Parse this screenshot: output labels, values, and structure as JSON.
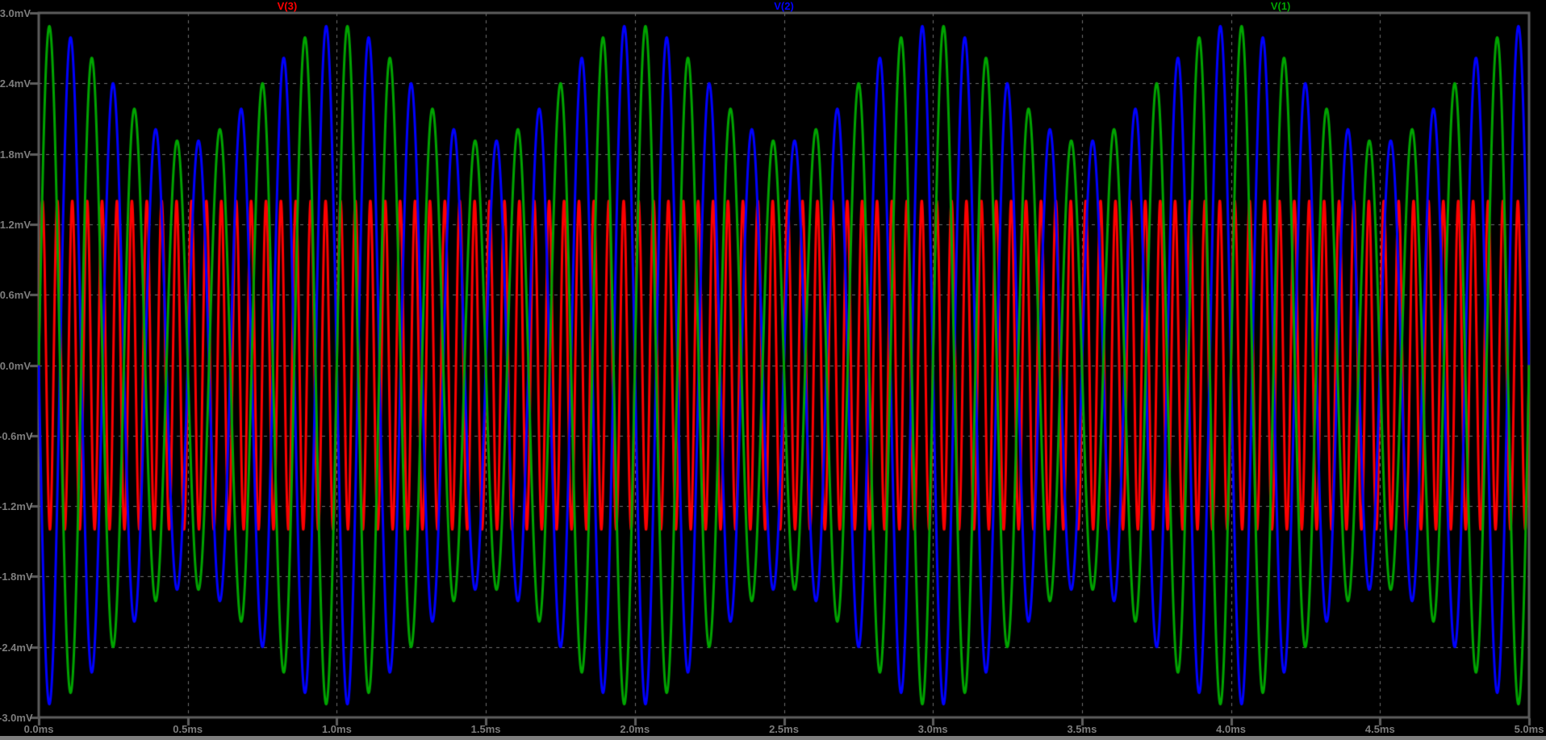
{
  "window": {
    "background_color": "#000000",
    "bottom_border_color": "#7f7f7f"
  },
  "plot": {
    "colors": {
      "grid": "#6f6f6f",
      "border": "#5e5e5e",
      "axis_text": "#7d7d7d",
      "plot_background": "#000000"
    },
    "trace_label_fractions": [
      0.1667,
      0.5,
      0.8333
    ]
  },
  "chart_data": {
    "type": "line",
    "title": "",
    "xlabel": "",
    "ylabel": "",
    "grid": true,
    "x_axis": {
      "unit": "ms",
      "min_ms": 0.0,
      "max_ms": 5.0,
      "tick_step_ms": 0.5,
      "tick_values_ms": [
        0.0,
        0.5,
        1.0,
        1.5,
        2.0,
        2.5,
        3.0,
        3.5,
        4.0,
        4.5,
        5.0
      ],
      "tick_labels": [
        "0.0ms",
        "0.5ms",
        "1.0ms",
        "1.5ms",
        "2.0ms",
        "2.5ms",
        "3.0ms",
        "3.5ms",
        "4.0ms",
        "4.5ms",
        "5.0ms"
      ]
    },
    "y_axis": {
      "unit": "mV",
      "min_mV": -3.0,
      "max_mV": 3.0,
      "tick_step_mV": 0.6,
      "tick_values_mV": [
        3.0,
        2.4,
        1.8,
        1.2,
        0.6,
        0.0,
        -0.6,
        -1.2,
        -1.8,
        -2.4,
        -3.0
      ],
      "tick_labels": [
        "3.0mV",
        "2.4mV",
        "1.8mV",
        "1.2mV",
        "0.6mV",
        "0.0mV",
        "-0.6mV",
        "-1.2mV",
        "-1.8mV",
        "-2.4mV",
        "-3.0mV"
      ]
    },
    "series": [
      {
        "name": "V(3)",
        "color": "#ff0000",
        "waveform": "sine",
        "amplitude_mV": 1.4,
        "carrier_Hz": 20000,
        "phase_deg": 0,
        "envelope_base_mV": 1.4,
        "envelope_depth_mV": 0,
        "envelope_Hz": 0
      },
      {
        "name": "V(2)",
        "color": "#0000ff",
        "waveform": "am_sine",
        "amplitude_mV": 2.9,
        "carrier_Hz": 7000,
        "phase_deg": 180,
        "envelope_base_mV": 2.4,
        "envelope_depth_mV": 0.5,
        "envelope_Hz": 1000
      },
      {
        "name": "V(1)",
        "color": "#00a400",
        "waveform": "am_sine",
        "amplitude_mV": 2.9,
        "carrier_Hz": 7000,
        "phase_deg": 0,
        "envelope_base_mV": 2.4,
        "envelope_depth_mV": 0.5,
        "envelope_Hz": 1000
      }
    ]
  }
}
